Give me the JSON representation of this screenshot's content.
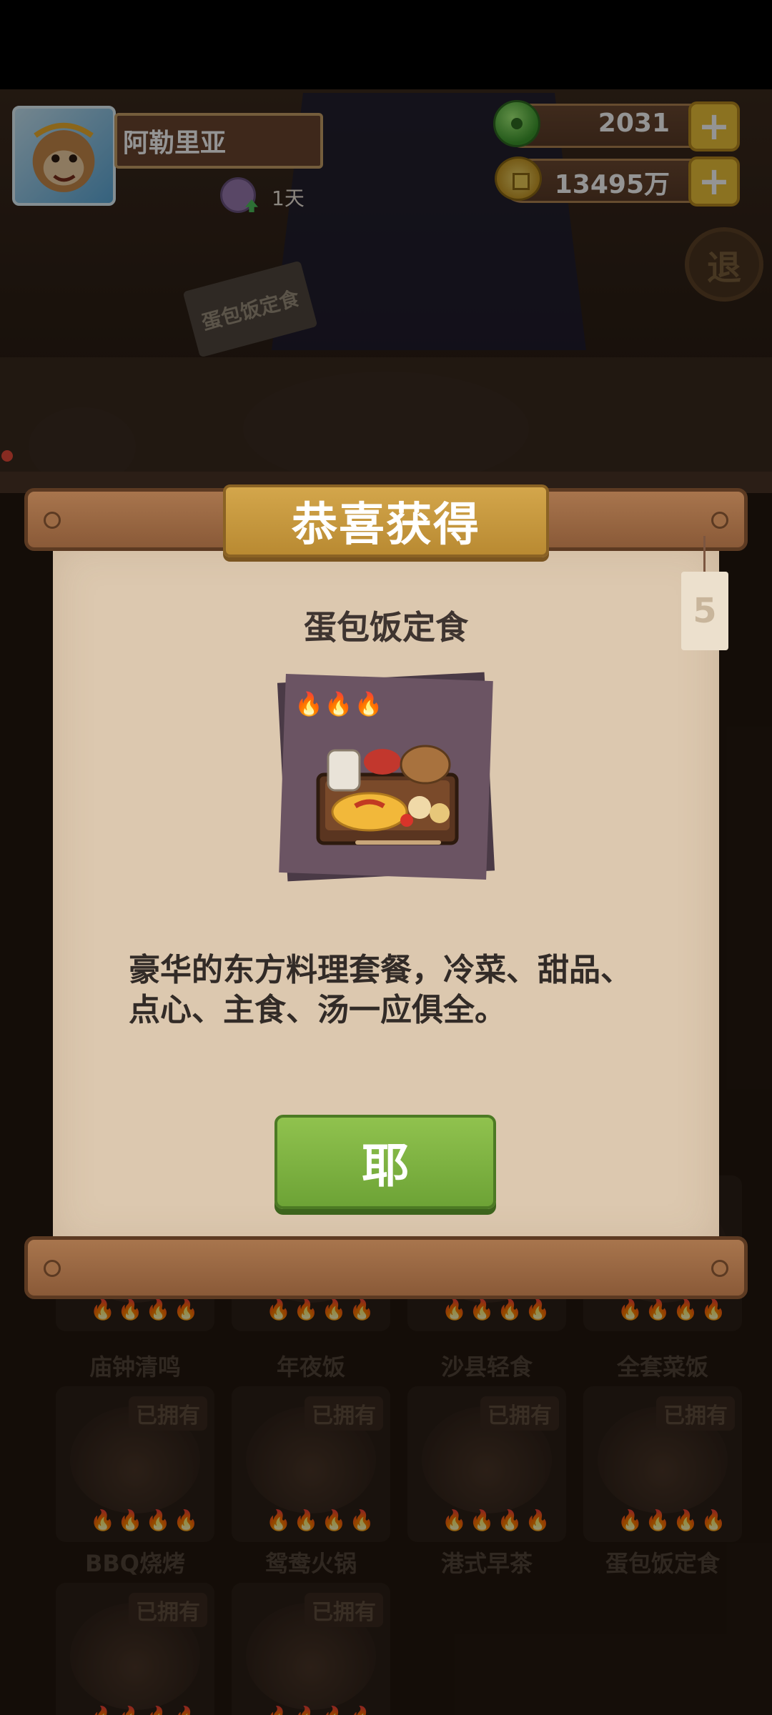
{
  "player": {
    "name": "阿勒里亚",
    "days": "1天"
  },
  "resources": {
    "jade": "2031",
    "coins": "13495万",
    "plus_label": "+"
  },
  "background": {
    "dish_sign": "蛋包饭定食",
    "exit_label": "退",
    "recipes": [
      {
        "name": "庙钟清鸣",
        "owned": ""
      },
      {
        "name": "年夜饭",
        "owned": ""
      },
      {
        "name": "沙县轻食",
        "owned": ""
      },
      {
        "name": "全套菜饭",
        "owned": ""
      },
      {
        "name": "BBQ烧烤",
        "owned": "已拥有"
      },
      {
        "name": "鸳鸯火锅",
        "owned": "已拥有"
      },
      {
        "name": "港式早茶",
        "owned": "已拥有"
      },
      {
        "name": "蛋包饭定食",
        "owned": "已拥有"
      },
      {
        "name": "",
        "owned": "已拥有"
      },
      {
        "name": "",
        "owned": "已拥有"
      }
    ]
  },
  "modal": {
    "title": "恭喜获得",
    "side_tag": "5",
    "item_name": "蛋包饭定食",
    "flames": "🔥🔥🔥",
    "description": "豪华的东方料理套餐，冷菜、甜品、点心、主食、汤一应俱全。",
    "confirm_label": "耶"
  },
  "colors": {
    "confirm_button": "#7fb442",
    "title_banner": "#c99a3c",
    "paper": "#dcc8af",
    "rod": "#9a6a44"
  }
}
